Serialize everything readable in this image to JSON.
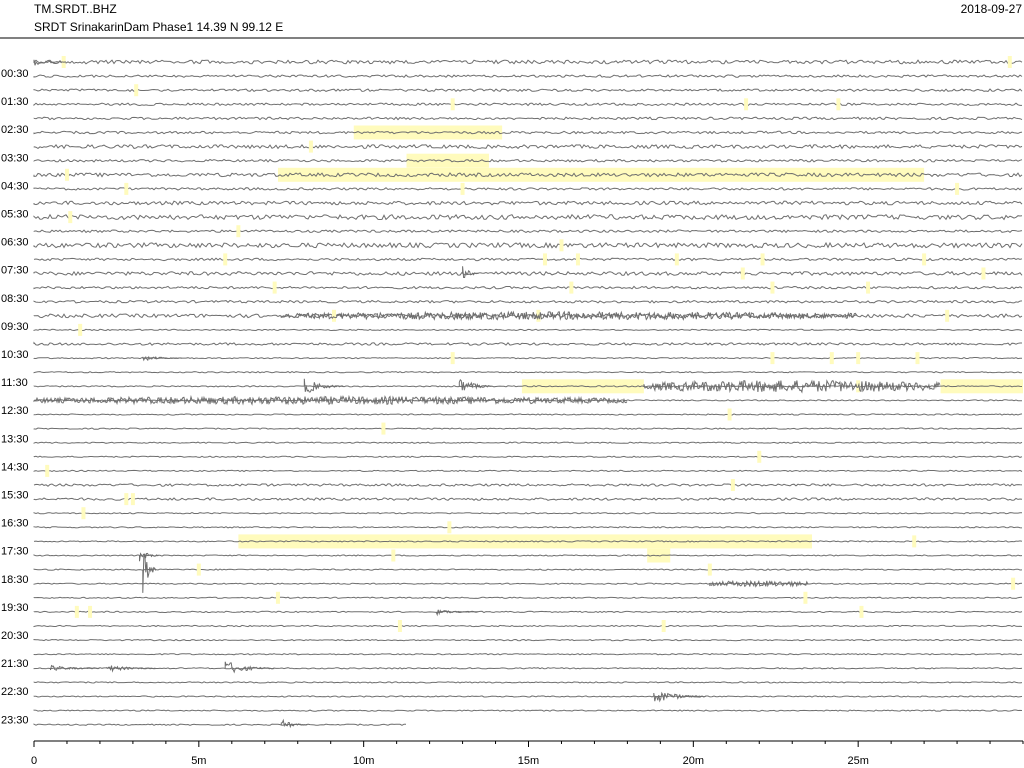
{
  "header": {
    "station_code": "TM.SRDT..BHZ",
    "station_description": "SRDT SrinakarinDam Phase1  14.39 N 99.12 E",
    "date": "2018-09-27"
  },
  "colors": {
    "trace": "#6e6e6e",
    "highlight": "#fffbbd",
    "axis": "#000000"
  },
  "chart_data": {
    "type": "helicorder",
    "title": "TM.SRDT..BHZ",
    "xlabel": "",
    "ylabel": "",
    "x_unit": "minutes",
    "xlim": [
      0,
      30
    ],
    "x_ticks": [
      0,
      5,
      10,
      15,
      20,
      25
    ],
    "x_tick_labels": [
      "0",
      "5m",
      "10m",
      "15m",
      "20m",
      "25m"
    ],
    "row_labels": [
      "00:30",
      "01:30",
      "02:30",
      "03:30",
      "04:30",
      "05:30",
      "06:30",
      "07:30",
      "08:30",
      "09:30",
      "10:30",
      "11:30",
      "12:30",
      "13:30",
      "14:30",
      "15:30",
      "16:30",
      "17:30",
      "18:30",
      "19:30",
      "20:30",
      "21:30",
      "22:30",
      "23:30"
    ],
    "line_count": 48,
    "noise_level": [
      3,
      2,
      2,
      2,
      2,
      2,
      3,
      2,
      3,
      2,
      3,
      4,
      2,
      4,
      2,
      3,
      2,
      2,
      3,
      1,
      2,
      1,
      1,
      1,
      1,
      1,
      1,
      1,
      1,
      1,
      2,
      2,
      1,
      1,
      1,
      1,
      1,
      1,
      1,
      1,
      1,
      1,
      1,
      1,
      1,
      1,
      1,
      1
    ],
    "highlights": [
      {
        "line": 5,
        "start_min": 9.7,
        "end_min": 14.2
      },
      {
        "line": 7,
        "start_min": 11.3,
        "end_min": 13.8
      },
      {
        "line": 8,
        "start_min": 7.4,
        "end_min": 27.0
      },
      {
        "line": 23,
        "start_min": 14.8,
        "end_min": 18.5
      },
      {
        "line": 23,
        "start_min": 27.5,
        "end_min": 30.0
      },
      {
        "line": 34,
        "start_min": 6.2,
        "end_min": 23.6
      },
      {
        "line": 35,
        "start_min": 18.6,
        "end_min": 19.3
      }
    ],
    "markers": [
      {
        "line": 0,
        "min": 0.9
      },
      {
        "line": 0,
        "min": 29.6
      },
      {
        "line": 2,
        "min": 3.1
      },
      {
        "line": 3,
        "min": 12.7
      },
      {
        "line": 3,
        "min": 21.6
      },
      {
        "line": 3,
        "min": 24.4
      },
      {
        "line": 6,
        "min": 8.4
      },
      {
        "line": 8,
        "min": 1.0
      },
      {
        "line": 9,
        "min": 2.8
      },
      {
        "line": 9,
        "min": 13.0
      },
      {
        "line": 9,
        "min": 28.0
      },
      {
        "line": 11,
        "min": 1.1
      },
      {
        "line": 12,
        "min": 6.2
      },
      {
        "line": 13,
        "min": 16.0
      },
      {
        "line": 14,
        "min": 5.8
      },
      {
        "line": 14,
        "min": 15.5
      },
      {
        "line": 14,
        "min": 16.5
      },
      {
        "line": 14,
        "min": 19.5
      },
      {
        "line": 14,
        "min": 22.1
      },
      {
        "line": 14,
        "min": 27.0
      },
      {
        "line": 15,
        "min": 21.5
      },
      {
        "line": 15,
        "min": 28.8
      },
      {
        "line": 16,
        "min": 7.3
      },
      {
        "line": 16,
        "min": 16.3
      },
      {
        "line": 16,
        "min": 22.4
      },
      {
        "line": 16,
        "min": 25.3
      },
      {
        "line": 18,
        "min": 9.1
      },
      {
        "line": 18,
        "min": 15.3
      },
      {
        "line": 18,
        "min": 27.7
      },
      {
        "line": 19,
        "min": 1.4
      },
      {
        "line": 21,
        "min": 12.7
      },
      {
        "line": 21,
        "min": 22.4
      },
      {
        "line": 21,
        "min": 24.2
      },
      {
        "line": 21,
        "min": 25.0
      },
      {
        "line": 21,
        "min": 26.8
      },
      {
        "line": 23,
        "min": 25.0
      },
      {
        "line": 25,
        "min": 21.1
      },
      {
        "line": 26,
        "min": 10.6
      },
      {
        "line": 28,
        "min": 22.0
      },
      {
        "line": 29,
        "min": 0.4
      },
      {
        "line": 30,
        "min": 21.2
      },
      {
        "line": 31,
        "min": 2.8
      },
      {
        "line": 31,
        "min": 3.0
      },
      {
        "line": 32,
        "min": 1.5
      },
      {
        "line": 33,
        "min": 12.6
      },
      {
        "line": 34,
        "min": 26.7
      },
      {
        "line": 35,
        "min": 10.9
      },
      {
        "line": 36,
        "min": 5.0
      },
      {
        "line": 36,
        "min": 20.5
      },
      {
        "line": 37,
        "min": 29.7
      },
      {
        "line": 38,
        "min": 7.4
      },
      {
        "line": 38,
        "min": 23.4
      },
      {
        "line": 39,
        "min": 1.3
      },
      {
        "line": 39,
        "min": 1.7
      },
      {
        "line": 39,
        "min": 25.1
      },
      {
        "line": 40,
        "min": 11.1
      },
      {
        "line": 40,
        "min": 19.1
      }
    ],
    "events": [
      {
        "line": 0,
        "min": 0.0,
        "duration_min": 1.0,
        "amplitude": 4
      },
      {
        "line": 15,
        "min": 13.0,
        "duration_min": 0.5,
        "amplitude": 9
      },
      {
        "line": 18,
        "min": 7.5,
        "duration_min": 17.5,
        "amplitude": 4
      },
      {
        "line": 21,
        "min": 3.3,
        "duration_min": 1.2,
        "amplitude": 3
      },
      {
        "line": 23,
        "min": 8.2,
        "duration_min": 1.2,
        "amplitude": 9
      },
      {
        "line": 23,
        "min": 12.9,
        "duration_min": 1.0,
        "amplitude": 10
      },
      {
        "line": 23,
        "min": 18.5,
        "duration_min": 9.0,
        "amplitude": 6
      },
      {
        "line": 24,
        "min": 0.0,
        "duration_min": 18.0,
        "amplitude": 4
      },
      {
        "line": 35,
        "min": 3.2,
        "duration_min": 0.6,
        "amplitude": 8
      },
      {
        "line": 36,
        "min": 3.3,
        "duration_min": 0.4,
        "amplitude": 26
      },
      {
        "line": 37,
        "min": 20.5,
        "duration_min": 3.0,
        "amplitude": 3
      },
      {
        "line": 39,
        "min": 12.2,
        "duration_min": 1.3,
        "amplitude": 3
      },
      {
        "line": 43,
        "min": 0.5,
        "duration_min": 1.5,
        "amplitude": 3
      },
      {
        "line": 43,
        "min": 2.2,
        "duration_min": 1.5,
        "amplitude": 4
      },
      {
        "line": 43,
        "min": 5.8,
        "duration_min": 1.5,
        "amplitude": 8
      },
      {
        "line": 45,
        "min": 18.8,
        "duration_min": 1.6,
        "amplitude": 8
      },
      {
        "line": 47,
        "min": 7.5,
        "duration_min": 0.8,
        "amplitude": 6
      }
    ],
    "last_line_end_min": 11.3
  }
}
